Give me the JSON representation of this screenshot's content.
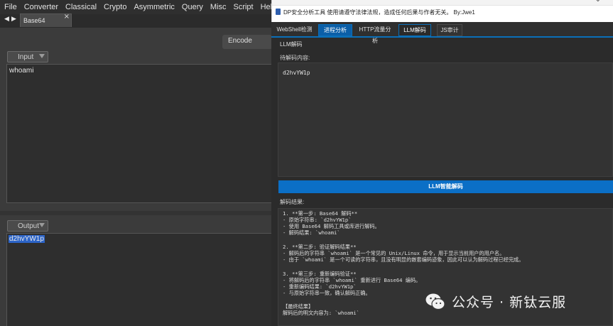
{
  "menubar": {
    "items": [
      "File",
      "Converter",
      "Classical",
      "Crypto",
      "Asymmetric",
      "Query",
      "Misc",
      "Script",
      "Help"
    ]
  },
  "tabs": {
    "nav_back": "◀",
    "nav_forward": "▶",
    "active_tab": "Base64",
    "close_glyph": "×"
  },
  "operation": {
    "button_label": "Encode"
  },
  "input": {
    "label": "Input",
    "value": "whoami"
  },
  "output": {
    "label": "Output",
    "value": "d2hvYW1p"
  },
  "tool_window": {
    "title": "DP安全分析工具 使用请遵守法律法规，造成任何后果与作者无关。 By:Jwe1",
    "tabs": [
      "WebShell检测",
      "进程分析",
      "HTTP流量分析",
      "LLM解码",
      "JS审计"
    ],
    "active_tab": "LLM解码",
    "section_title": "LLM解码",
    "pending_label": "待解码内容:",
    "pending_value": "d2hvYW1p",
    "decode_button": "LLM智能解码",
    "result_label": "解码结果:",
    "result_lines": [
      "1. **第一步: Base64 解码**",
      "   - 原始字符串: `d2hvYW1p`",
      "   - 使用 Base64 解码工具或库进行解码。",
      "   - 解码结果: `whoami`",
      "",
      "2. **第二步: 验证解码结果**",
      "   - 解码后的字符串 `whoami` 是一个常见的 Unix/Linux 命令，用于显示当前用户的用户名。",
      "   - 由于 `whoami` 是一个可读的字符串，且没有明显的嵌套编码迹象，因此可以认为解码过程已经完成。",
      "",
      "3. **第三步: 重新编码验证**",
      "   - 将解码后的字符串 `whoami` 重新进行 Base64 编码。",
      "   - 重新编码结果: `d2hvYW1p`",
      "   - 与原始字符串一致，确认解码正确。",
      "",
      "【最终结果】",
      "解码后的明文内容为: `whoami`"
    ]
  },
  "watermark": {
    "text": "公众号 · 新钛云服"
  },
  "colors": {
    "accent_blue": "#0b6fc6",
    "selection_blue": "#2c64c8",
    "dark_bg": "#2b2b2b"
  }
}
